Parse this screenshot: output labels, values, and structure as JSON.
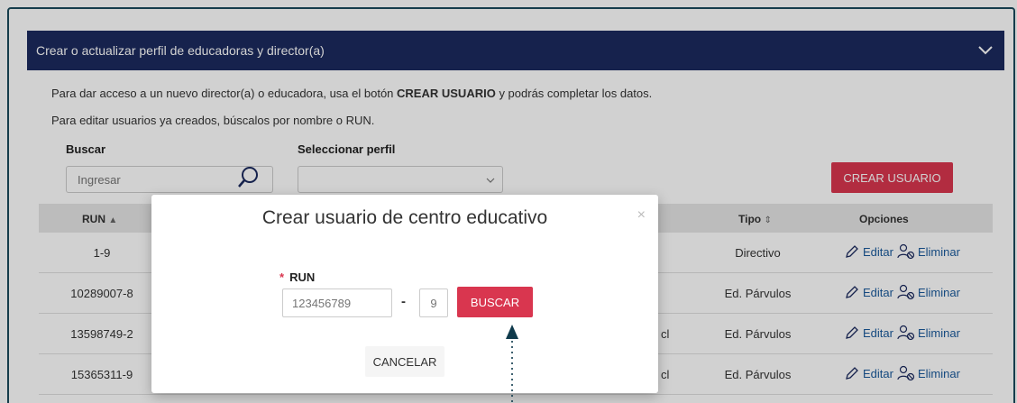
{
  "panel": {
    "title": "Crear o actualizar perfil de educadoras y director(a)",
    "intro_1_pre": "Para dar acceso a un nuevo director(a) o educadora, usa el botón ",
    "intro_1_bold": "CREAR USUARIO",
    "intro_1_post": " y podrás completar los datos.",
    "intro_2": "Para editar usuarios ya creados, búscalos por nombre o RUN."
  },
  "filters": {
    "search_label": "Buscar",
    "search_placeholder": "Ingresar",
    "perfil_label": "Seleccionar perfil",
    "perfil_value": ""
  },
  "actions": {
    "crear_usuario": "CREAR USUARIO"
  },
  "table": {
    "headers": {
      "run": "RUN",
      "run_sort": "▲",
      "tipo": "Tipo",
      "tipo_sort": "⇕",
      "opciones": "Opciones"
    },
    "rows": [
      {
        "run": "1-9",
        "extra": "",
        "tipo": "Directivo",
        "editar": "Editar",
        "eliminar": "Eliminar"
      },
      {
        "run": "10289007-8",
        "extra": "",
        "tipo": "Ed. Párvulos",
        "editar": "Editar",
        "eliminar": "Eliminar"
      },
      {
        "run": "13598749-2",
        "extra": "cl",
        "tipo": "Ed. Párvulos",
        "editar": "Editar",
        "eliminar": "Eliminar"
      },
      {
        "run": "15365311-9",
        "extra": "cl",
        "tipo": "Ed. Párvulos",
        "editar": "Editar",
        "eliminar": "Eliminar"
      }
    ]
  },
  "modal": {
    "title": "Crear usuario de centro educativo",
    "close": "×",
    "run_required_mark": "*",
    "run_label": "RUN",
    "run_placeholder": "123456789",
    "dash": "-",
    "dv_placeholder": "9",
    "buscar": "BUSCAR",
    "cancelar": "CANCELAR"
  },
  "colors": {
    "header_bg": "#1b2a5e",
    "accent": "#d9364f",
    "link": "#1a5a9c"
  }
}
